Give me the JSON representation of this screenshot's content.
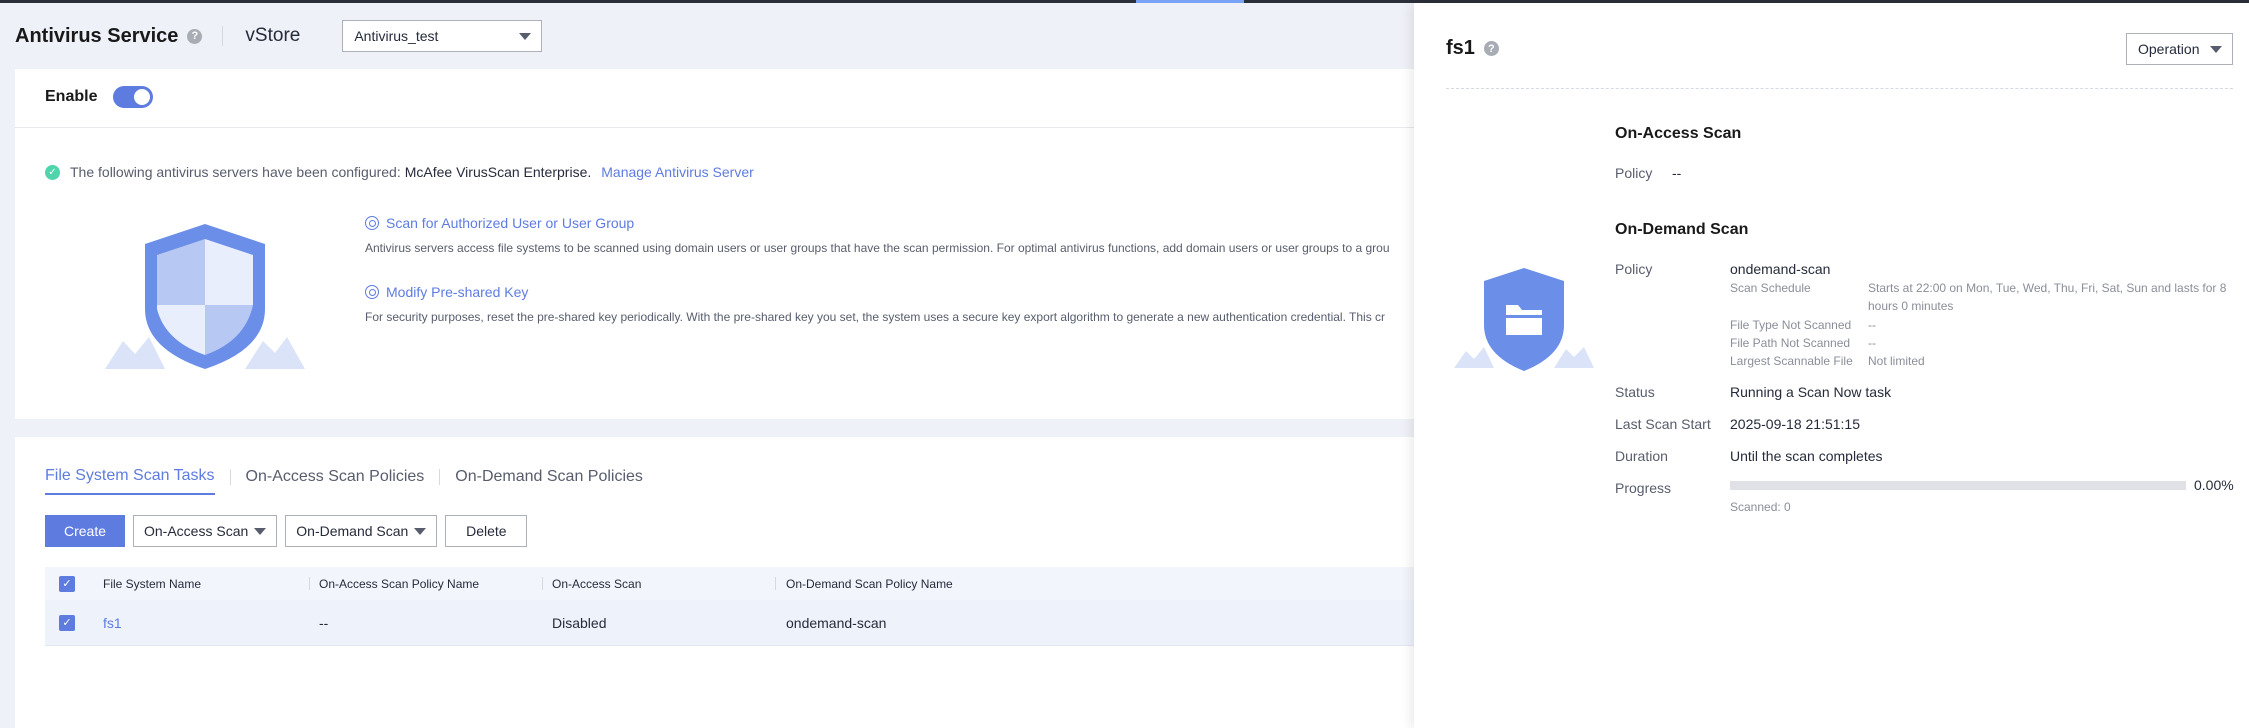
{
  "header": {
    "title": "Antivirus Service",
    "vstore_label": "vStore",
    "vstore_value": "Antivirus_test"
  },
  "settings": {
    "enable_label": "Enable",
    "enabled": true
  },
  "notice": {
    "text": "The following antivirus servers have been configured:",
    "server": "McAfee VirusScan Enterprise.",
    "manage_link": "Manage Antivirus Server"
  },
  "features": [
    {
      "title": "Scan for Authorized User or User Group",
      "desc": "Antivirus servers access file systems to be scanned using domain users or user groups that have the scan permission. For optimal antivirus functions, add domain users or user groups to a grou"
    },
    {
      "title": "Modify Pre-shared Key",
      "desc": "For security purposes, reset the pre-shared key periodically. With the pre-shared key you set, the system uses a secure key export algorithm to generate a new authentication credential. This cr"
    }
  ],
  "tabs": [
    "File System Scan Tasks",
    "On-Access Scan Policies",
    "On-Demand Scan Policies"
  ],
  "toolbar": {
    "create": "Create",
    "on_access": "On-Access Scan",
    "on_demand": "On-Demand Scan",
    "delete": "Delete"
  },
  "table": {
    "columns": [
      "File System Name",
      "On-Access Scan Policy Name",
      "On-Access Scan",
      "On-Demand Scan Policy Name"
    ],
    "rows": [
      {
        "name": "fs1",
        "on_access_policy": "--",
        "on_access_scan": "Disabled",
        "on_demand_policy": "ondemand-scan"
      }
    ]
  },
  "drawer": {
    "title": "fs1",
    "operation": "Operation",
    "on_access": {
      "title": "On-Access Scan",
      "policy_label": "Policy",
      "policy_value": "--"
    },
    "on_demand": {
      "title": "On-Demand Scan",
      "policy_label": "Policy",
      "policy_value": "ondemand-scan",
      "schedule_label": "Scan Schedule",
      "schedule_value": "Starts at 22:00 on Mon, Tue, Wed, Thu, Fri, Sat, Sun and lasts for 8 hours 0 minutes",
      "file_type_label": "File Type Not Scanned",
      "file_type_value": "--",
      "file_path_label": "File Path Not Scanned",
      "file_path_value": "--",
      "largest_label": "Largest Scannable File",
      "largest_value": "Not limited"
    },
    "status_label": "Status",
    "status_value": "Running a Scan Now task",
    "last_scan_label": "Last Scan Start",
    "last_scan_value": "2025-09-18 21:51:15",
    "duration_label": "Duration",
    "duration_value": "Until the scan completes",
    "progress_label": "Progress",
    "progress_percent": 0,
    "progress_text": "0.00%",
    "scanned_text": "Scanned: 0"
  }
}
